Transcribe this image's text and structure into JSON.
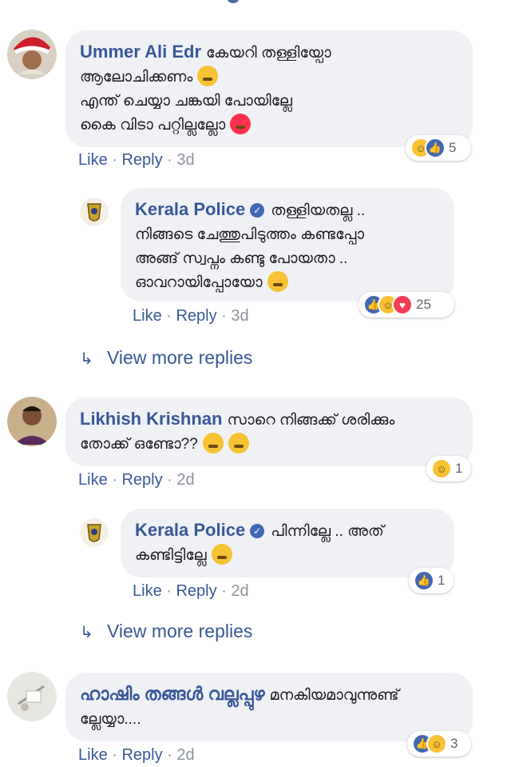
{
  "comments": [
    {
      "author": "Ummer Ali Edr",
      "lines": [
        "കേയറി തള്ളിയ്പോ",
        "ആലോചിക്കണം",
        "എന്ത് ചെയ്യാ ചങ്കയി പോയില്ലേ",
        "കൈ വിടാ പറ്റില്ലല്ലോ"
      ],
      "actions": {
        "like": "Like",
        "sep": " · ",
        "reply": "Reply",
        "time": "3d"
      },
      "reaction_count": "5"
    },
    {
      "author": "Kerala Police",
      "lines": [
        "തള്ളിയതല്ല ..",
        "നിങ്ങടെ ചേത്തുപിടുത്തം കണ്ടപ്പോ",
        "അങ്ങ് സ്വപ്നം കണ്ടു പോയതാ ..",
        "ഓവറായിപ്പോയോ"
      ],
      "actions": {
        "like": "Like",
        "sep": " · ",
        "reply": "Reply",
        "time": "3d"
      },
      "reaction_count": "25"
    },
    {
      "author": "Likhish Krishnan",
      "lines": [
        "സാറെ നിങ്ങക്ക് ശരിക്കും",
        "തോക്ക് ഒണ്ടോ??"
      ],
      "actions": {
        "like": "Like",
        "sep": " · ",
        "reply": "Reply",
        "time": "2d"
      },
      "reaction_count": "1"
    },
    {
      "author": "Kerala Police",
      "lines": [
        "പിന്നില്ലേ .. അത്",
        "കണ്ടിട്ടില്ലേ"
      ],
      "actions": {
        "like": "Like",
        "sep": " · ",
        "reply": "Reply",
        "time": "2d"
      },
      "reaction_count": "1"
    },
    {
      "author": "ഹാഷിം തങ്ങൾ വല്ലപ്പുഴ",
      "lines": [
        "മനകിയമാവുന്നുണ്ട്",
        "ല്ലേയ്യാ...."
      ],
      "actions": {
        "like": "Like",
        "sep": " · ",
        "reply": "Reply",
        "time": "2d"
      },
      "reaction_count": "3"
    }
  ],
  "view_more": [
    "View more replies",
    "View more replies"
  ],
  "colors": {
    "link": "#385898",
    "bubble": "#eff1f4",
    "meta": "#8d949e"
  }
}
